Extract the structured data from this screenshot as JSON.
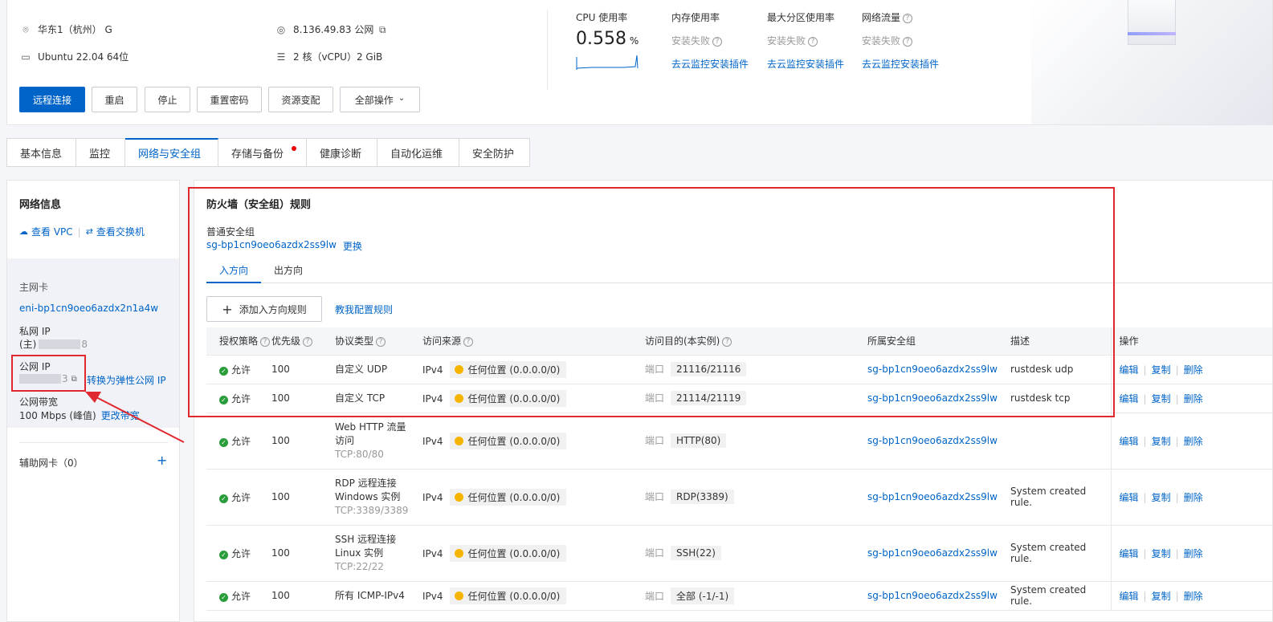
{
  "instance": {
    "region": "华东1（杭州） G",
    "ip": "8.136.49.83 公网",
    "os": "Ubuntu 22.04 64位",
    "spec": "2 核（vCPU）2 GiB",
    "icons": {
      "region": "location-icon",
      "ip": "target-icon",
      "os": "monitor-icon",
      "spec": "sliders-icon",
      "copy": "copy-icon"
    }
  },
  "actions": {
    "remote": "远程连接",
    "reboot": "重启",
    "stop": "停止",
    "reset_pwd": "重置密码",
    "resize": "资源变配",
    "all": "全部操作",
    "all_caret": "⌄"
  },
  "metrics": {
    "cpu": {
      "title": "CPU 使用率",
      "value": "0.558",
      "unit": "%"
    },
    "mem": {
      "title": "内存使用率",
      "status": "安装失败",
      "link": "去云监控安装插件"
    },
    "disk": {
      "title": "最大分区使用率",
      "status": "安装失败",
      "link": "去云监控安装插件"
    },
    "net": {
      "title": "网络流量",
      "status": "安装失败",
      "link": "去云监控安装插件"
    }
  },
  "tabs": [
    "基本信息",
    "监控",
    "网络与安全组",
    "存储与备份",
    "健康诊断",
    "自动化运维",
    "安全防护"
  ],
  "active_tab": "网络与安全组",
  "network": {
    "title": "网络信息",
    "vpc_link": "查看 VPC",
    "vswitch_link": "查看交换机",
    "primary_nic_label": "主网卡",
    "primary_nic_id": "eni-bp1cn9oeo6azdx2n1a4w",
    "private_ip_label": "私网 IP",
    "private_ip_prefix": "(主)",
    "private_ip_tail": "8",
    "public_ip_label": "公网 IP",
    "public_ip_tail": "3",
    "eip_link": "转换为弹性公网 IP",
    "bandwidth_label": "公网带宽",
    "bandwidth_value": "100 Mbps (峰值)",
    "bandwidth_link": "更改带宽",
    "secondary_nic": "辅助网卡（0）"
  },
  "firewall": {
    "title": "防火墙（安全组）规则",
    "group_type": "普通安全组",
    "group_id": "sg-bp1cn9oeo6azdx2ss9lw",
    "change": "更换",
    "directions": [
      "入方向",
      "出方向"
    ],
    "add_rule": "添加入方向规则",
    "help_link": "教我配置规则",
    "columns": [
      "授权策略",
      "优先级",
      "协议类型",
      "访问来源",
      "访问目的(本实例)",
      "所属安全组",
      "描述",
      "操作"
    ],
    "ops": [
      "编辑",
      "复制",
      "删除"
    ],
    "rows": [
      {
        "policy": "允许",
        "priority": "100",
        "proto": "自定义 UDP",
        "proto2": "",
        "proto_sub": "",
        "ipver": "IPv4",
        "source": "任何位置 (0.0.0.0/0)",
        "port_label": "端口",
        "port": "21116/21116",
        "sg": "sg-bp1cn9oeo6azdx2ss9lw",
        "desc": "rustdesk udp"
      },
      {
        "policy": "允许",
        "priority": "100",
        "proto": "自定义 TCP",
        "proto2": "",
        "proto_sub": "",
        "ipver": "IPv4",
        "source": "任何位置 (0.0.0.0/0)",
        "port_label": "端口",
        "port": "21114/21119",
        "sg": "sg-bp1cn9oeo6azdx2ss9lw",
        "desc": "rustdesk tcp"
      },
      {
        "policy": "允许",
        "priority": "100",
        "proto": "Web HTTP 流量",
        "proto2": "访问",
        "proto_sub": "TCP:80/80",
        "ipver": "IPv4",
        "source": "任何位置 (0.0.0.0/0)",
        "port_label": "端口",
        "port": "HTTP(80)",
        "sg": "sg-bp1cn9oeo6azdx2ss9lw",
        "desc": ""
      },
      {
        "policy": "允许",
        "priority": "100",
        "proto": "RDP 远程连接",
        "proto2": "Windows 实例",
        "proto_sub": "TCP:3389/3389",
        "ipver": "IPv4",
        "source": "任何位置 (0.0.0.0/0)",
        "port_label": "端口",
        "port": "RDP(3389)",
        "sg": "sg-bp1cn9oeo6azdx2ss9lw",
        "desc": "System created rule."
      },
      {
        "policy": "允许",
        "priority": "100",
        "proto": "SSH 远程连接",
        "proto2": "Linux 实例",
        "proto_sub": "TCP:22/22",
        "ipver": "IPv4",
        "source": "任何位置 (0.0.0.0/0)",
        "port_label": "端口",
        "port": "SSH(22)",
        "sg": "sg-bp1cn9oeo6azdx2ss9lw",
        "desc": "System created rule."
      },
      {
        "policy": "允许",
        "priority": "100",
        "proto": "所有 ICMP-IPv4",
        "proto2": "",
        "proto_sub": "",
        "ipver": "IPv4",
        "source": "任何位置 (0.0.0.0/0)",
        "port_label": "端口",
        "port": "全部 (-1/-1)",
        "sg": "sg-bp1cn9oeo6azdx2ss9lw",
        "desc": "System created rule."
      }
    ]
  },
  "colors": {
    "primary": "#0064c8",
    "annotation": "#e0282e",
    "allow": "#2a9d3b",
    "any_dot": "#f5b400"
  }
}
